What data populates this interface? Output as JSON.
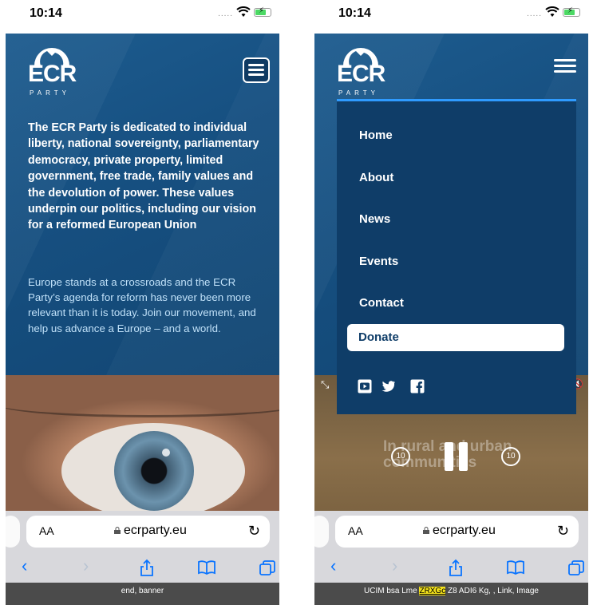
{
  "left": {
    "status": {
      "time": "10:14",
      "signal": "....."
    },
    "logo": {
      "word": "ECR",
      "sub": "PARTY"
    },
    "lead_text": "The ECR Party is dedicated to individual liberty, national sovereignty, parliamentary democracy, private property, limited government, free trade, family values and the devolution of power. These values underpin our politics, including our vision for a reformed European Union",
    "intro_text": "Europe stands at a crossroads and the ECR Party’s agenda for reform has never been more relevant than it is today. Join our movement, and help us advance a Europe – and a world.",
    "browser": {
      "aa": "AA",
      "url": "ecrparty.eu"
    },
    "footer": "end, banner"
  },
  "right": {
    "status": {
      "time": "10:14",
      "signal": "....."
    },
    "logo": {
      "word": "ECR",
      "sub": "PARTY"
    },
    "nav": {
      "home": "Home",
      "about": "About",
      "news": "News",
      "events": "Events",
      "contact": "Contact",
      "donate": "Donate"
    },
    "video": {
      "caption": "In rural and urban communities",
      "skip_back": "10",
      "skip_forward": "10"
    },
    "browser": {
      "aa": "AA",
      "url": "ecrparty.eu"
    },
    "footer": {
      "before": "UCIM bsa Lme ",
      "highlight": "ZRXGc",
      "after": " Z8 ADI6 Kg, , Link, Image"
    }
  },
  "colors": {
    "brand_blue": "#164f80",
    "nav_panel": "#0f3d68",
    "nav_accent": "#2f9bff",
    "ios_blue": "#0a74ff"
  },
  "icons": [
    "wifi-icon",
    "battery-icon",
    "menu-icon",
    "lock-icon",
    "reload-icon",
    "back-icon",
    "forward-icon",
    "share-icon",
    "bookmarks-icon",
    "tabs-icon",
    "youtube-icon",
    "twitter-icon",
    "facebook-icon",
    "pause-icon",
    "expand-icon",
    "mute-icon"
  ]
}
